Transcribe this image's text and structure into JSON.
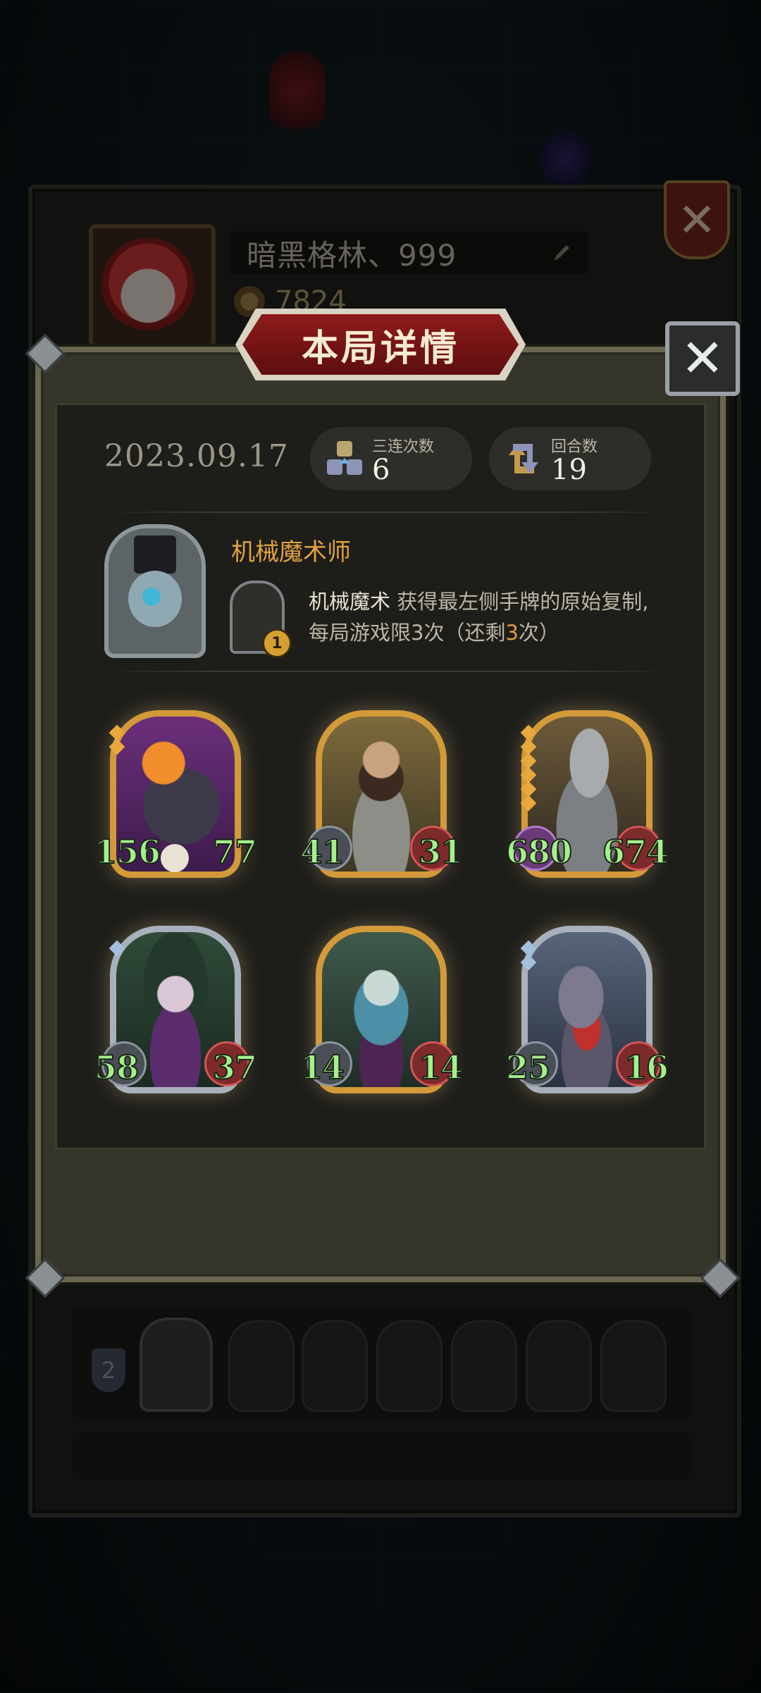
{
  "profile": {
    "name": "暗黑格林、999",
    "coins": "7824"
  },
  "modal": {
    "title": "本局详情",
    "date": "2023.09.17",
    "stats": [
      {
        "label": "三连次数",
        "value": "6"
      },
      {
        "label": "回合数",
        "value": "19"
      }
    ],
    "hero": {
      "name": "机械魔术师",
      "skill_badge": "1",
      "skill_name": "机械魔术",
      "skill_text_1": " 获得最左侧手牌的原始复制,",
      "skill_text_2": "每局游戏限3次（还剩",
      "skill_remaining": "3",
      "skill_text_3": "次）"
    },
    "cards": [
      {
        "name": "flame-beast",
        "atk": "156",
        "hp": "77",
        "frame": "gold",
        "stars": 2
      },
      {
        "name": "bearded-barbarian",
        "atk": "41",
        "hp": "31",
        "frame": "gold",
        "stars": 0
      },
      {
        "name": "armored-knight",
        "atk": "680",
        "hp": "674",
        "frame": "gold",
        "stars": 6
      },
      {
        "name": "horned-witch",
        "atk": "58",
        "hp": "37",
        "frame": "silver",
        "stars": 1
      },
      {
        "name": "elf-sorceress",
        "atk": "14",
        "hp": "14",
        "frame": "gold",
        "stars": 0
      },
      {
        "name": "rat-rogue",
        "atk": "25",
        "hp": "16",
        "frame": "silver",
        "stars": 2
      }
    ]
  },
  "history": [
    {
      "rank": "2"
    }
  ],
  "colors": {
    "accent_gold": "#d39a3a",
    "title_red": "#8e1b1b",
    "stat_green": "#a4f08a",
    "hero_name": "#e3a23e"
  }
}
